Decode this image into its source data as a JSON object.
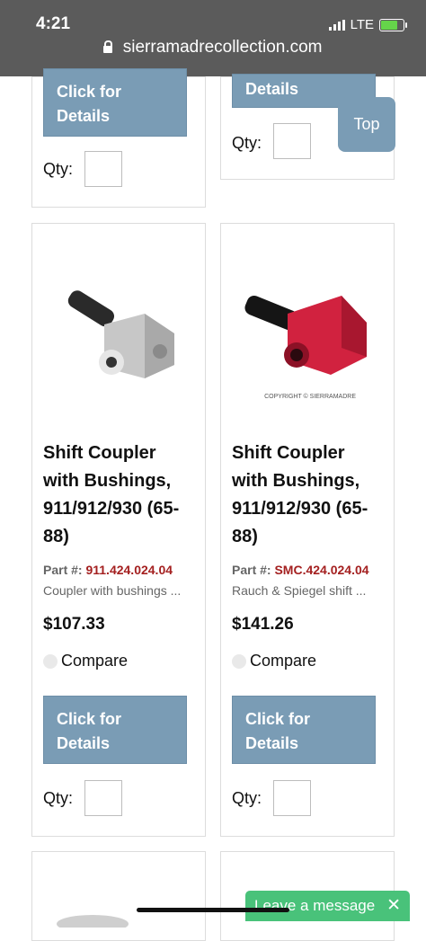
{
  "status": {
    "time": "4:21",
    "network": "LTE"
  },
  "browser": {
    "url": "sierramadrecollection.com"
  },
  "top_button": "Top",
  "cards_top": [
    {
      "button": "Click for Details",
      "qty_label": "Qty:"
    },
    {
      "button": "Details",
      "qty_label": "Qty:"
    }
  ],
  "products": [
    {
      "title": "Shift Coupler with Bushings, 911/912/930 (65-88)",
      "part_label": "Part #:",
      "part_number": "911.424.024.04",
      "description": "Coupler with bushings ...",
      "price": "$107.33",
      "compare": "Compare",
      "button": "Click for Details",
      "qty_label": "Qty:"
    },
    {
      "title": "Shift Coupler with Bushings, 911/912/930 (65-88)",
      "part_label": "Part #:",
      "part_number": "SMC.424.024.04",
      "description": "Rauch & Spiegel shift ...",
      "price": "$141.26",
      "compare": "Compare",
      "button": "Click for Details",
      "qty_label": "Qty:"
    }
  ],
  "chat": {
    "label": "Leave a message",
    "close": "✕"
  }
}
